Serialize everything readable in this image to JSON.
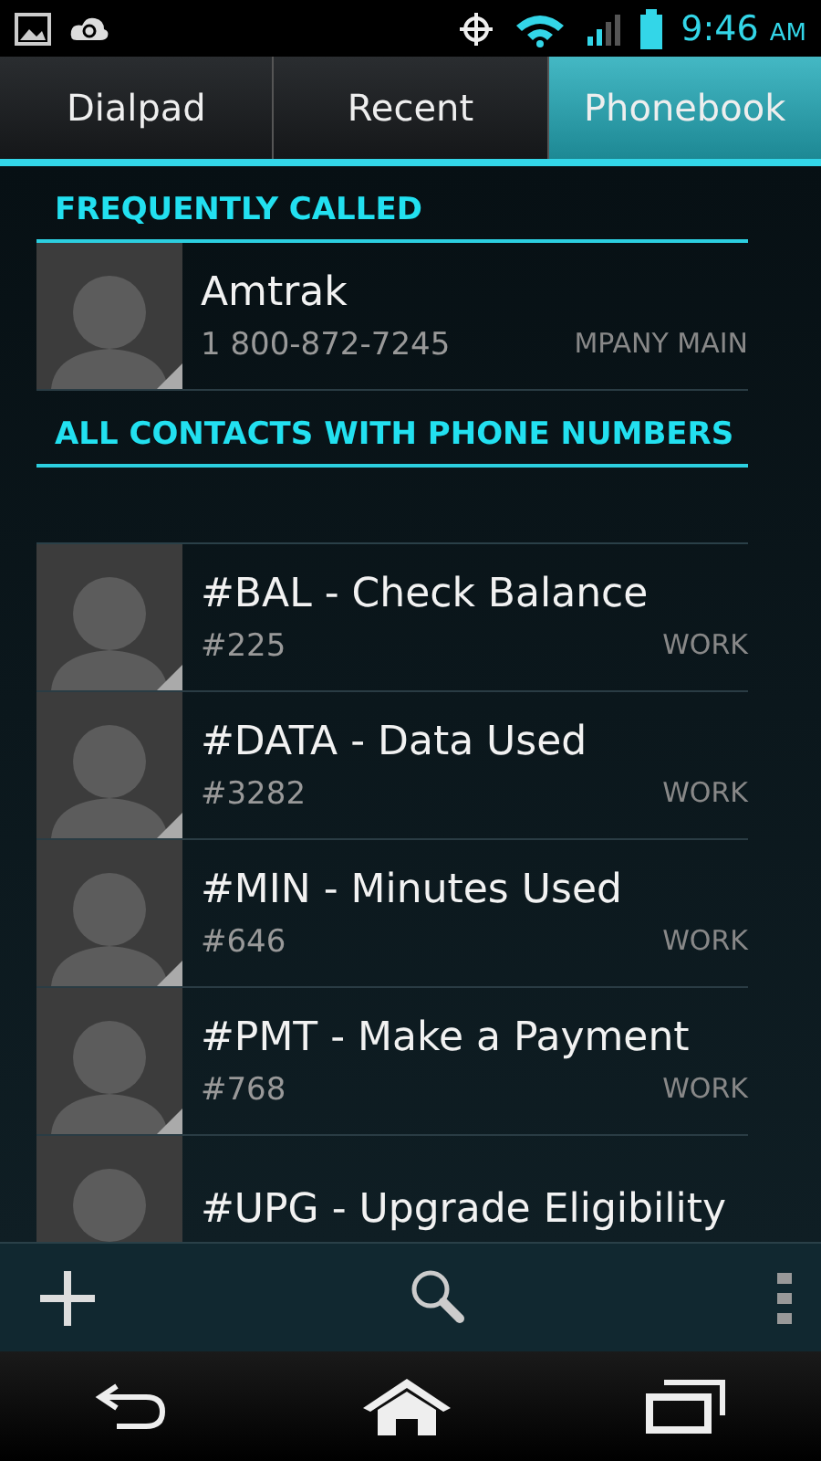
{
  "status_bar": {
    "time": "9:46",
    "ampm": "AM"
  },
  "tabs": [
    {
      "label": "Dialpad",
      "selected": false
    },
    {
      "label": "Recent",
      "selected": false
    },
    {
      "label": "Phonebook",
      "selected": true
    }
  ],
  "sections": [
    {
      "title": "FREQUENTLY CALLED",
      "contacts": [
        {
          "name": "Amtrak",
          "number": "1 800-872-7245",
          "type": "MPANY MAIN"
        }
      ]
    },
    {
      "title": "ALL CONTACTS WITH PHONE NUMBERS",
      "contacts": [
        {
          "name": "#BAL - Check Balance",
          "number": "#225",
          "type": "WORK"
        },
        {
          "name": "#DATA - Data Used",
          "number": "#3282",
          "type": "WORK"
        },
        {
          "name": "#MIN - Minutes Used",
          "number": "#646",
          "type": "WORK"
        },
        {
          "name": "#PMT - Make a Payment",
          "number": "#768",
          "type": "WORK"
        },
        {
          "name": "#UPG - Upgrade Eligibility"
        }
      ]
    }
  ]
}
